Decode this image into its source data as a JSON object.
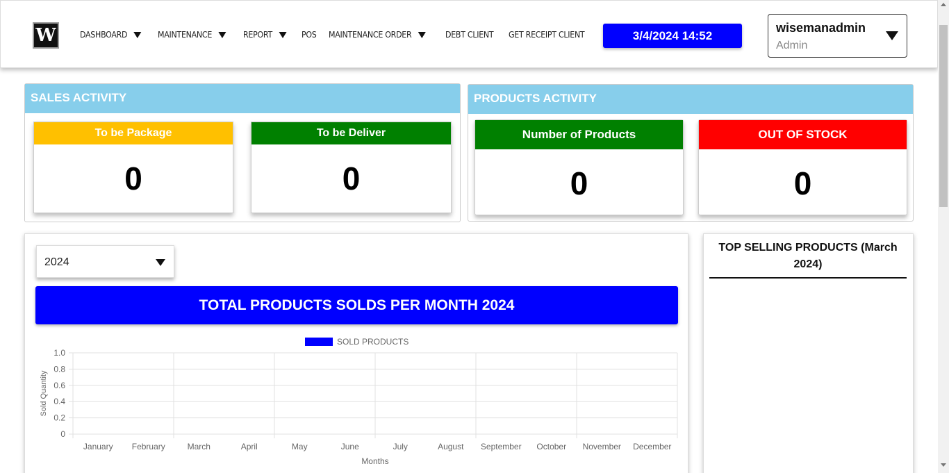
{
  "header": {
    "logo_alt": "W",
    "nav": [
      {
        "label": "DASHBOARD",
        "dropdown": true
      },
      {
        "label": "MAINTENANCE",
        "dropdown": true
      },
      {
        "label": "REPORT",
        "dropdown": true
      },
      {
        "label": "POS",
        "dropdown": false
      },
      {
        "label": "MAINTENANCE ORDER",
        "dropdown": true
      },
      {
        "label": "DEBT CLIENT",
        "dropdown": false
      },
      {
        "label": "GET RECEIPT CLIENT",
        "dropdown": false
      }
    ],
    "datetime": "3/4/2024 14:52",
    "user": {
      "name": "wisemanadmin",
      "role": "Admin"
    }
  },
  "sales_activity": {
    "title": "SALES ACTIVITY",
    "cards": [
      {
        "label": "To be Package",
        "value": "0",
        "color": "#ffc000"
      },
      {
        "label": "To be Deliver",
        "value": "0",
        "color": "#008000"
      }
    ]
  },
  "products_activity": {
    "title": "PRODUCTS ACTIVITY",
    "cards": [
      {
        "label": "Number of Products",
        "value": "0",
        "color": "#008000"
      },
      {
        "label": "OUT OF STOCK",
        "value": "0",
        "color": "#ff0000"
      }
    ]
  },
  "year_select": {
    "value": "2024"
  },
  "chart_title": "TOTAL PRODUCTS SOLDS PER MONTH 2024",
  "top_selling": {
    "title": "TOP SELLING PRODUCTS (March 2024)"
  },
  "chart_data": {
    "type": "bar",
    "categories": [
      "January",
      "February",
      "March",
      "April",
      "May",
      "June",
      "July",
      "August",
      "September",
      "October",
      "November",
      "December"
    ],
    "series": [
      {
        "name": "SOLD PRODUCTS",
        "values": [
          0,
          0,
          0,
          0,
          0,
          0,
          0,
          0,
          0,
          0,
          0,
          0
        ],
        "color": "#0000ff"
      }
    ],
    "xlabel": "Months",
    "ylabel": "Sold Quantity",
    "ylim": [
      0,
      1.0
    ],
    "yticks": [
      "0",
      "0.2",
      "0.4",
      "0.6",
      "0.8",
      "1.0"
    ],
    "grid": true,
    "legend": "top"
  }
}
